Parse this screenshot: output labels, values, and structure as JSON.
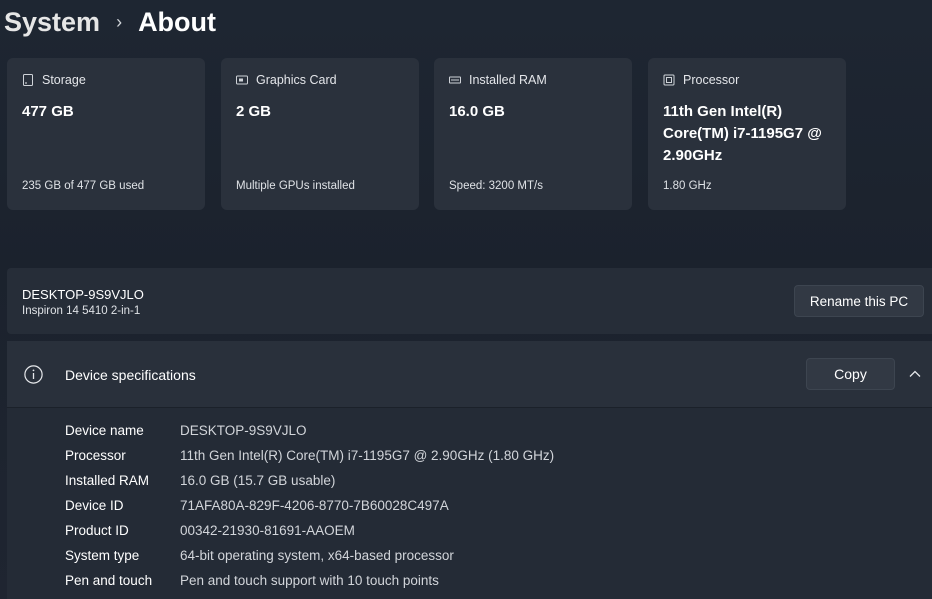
{
  "breadcrumb": {
    "parent": "System",
    "separator": "›",
    "current": "About"
  },
  "cards": [
    {
      "icon": "storage-icon",
      "label": "Storage",
      "value": "477 GB",
      "sub": "235 GB of 477 GB used"
    },
    {
      "icon": "graphics-card-icon",
      "label": "Graphics Card",
      "value": "2 GB",
      "sub": "Multiple GPUs installed"
    },
    {
      "icon": "ram-icon",
      "label": "Installed RAM",
      "value": "16.0 GB",
      "sub": "Speed: 3200 MT/s"
    },
    {
      "icon": "processor-icon",
      "label": "Processor",
      "value": "11th Gen Intel(R) Core(TM) i7-1195G7 @ 2.90GHz",
      "sub": "1.80 GHz"
    }
  ],
  "pc": {
    "name": "DESKTOP-9S9VJLO",
    "model": "Inspiron 14 5410 2-in-1",
    "rename_label": "Rename this PC"
  },
  "specs": {
    "title": "Device specifications",
    "copy_label": "Copy",
    "rows": [
      {
        "label": "Device name",
        "value": "DESKTOP-9S9VJLO"
      },
      {
        "label": "Processor",
        "value": "11th Gen Intel(R) Core(TM) i7-1195G7 @ 2.90GHz (1.80 GHz)"
      },
      {
        "label": "Installed RAM",
        "value": "16.0 GB (15.7 GB usable)"
      },
      {
        "label": "Device ID",
        "value": "71AFA80A-829F-4206-8770-7B60028C497A"
      },
      {
        "label": "Product ID",
        "value": "00342-21930-81691-AAOEM"
      },
      {
        "label": "System type",
        "value": "64-bit operating system, x64-based processor"
      },
      {
        "label": "Pen and touch",
        "value": "Pen and touch support with 10 touch points"
      }
    ]
  },
  "colors": {
    "background": "#1c2430",
    "card": "#2a313c",
    "text": "#ffffff",
    "muted_text": "#d2d5da"
  }
}
